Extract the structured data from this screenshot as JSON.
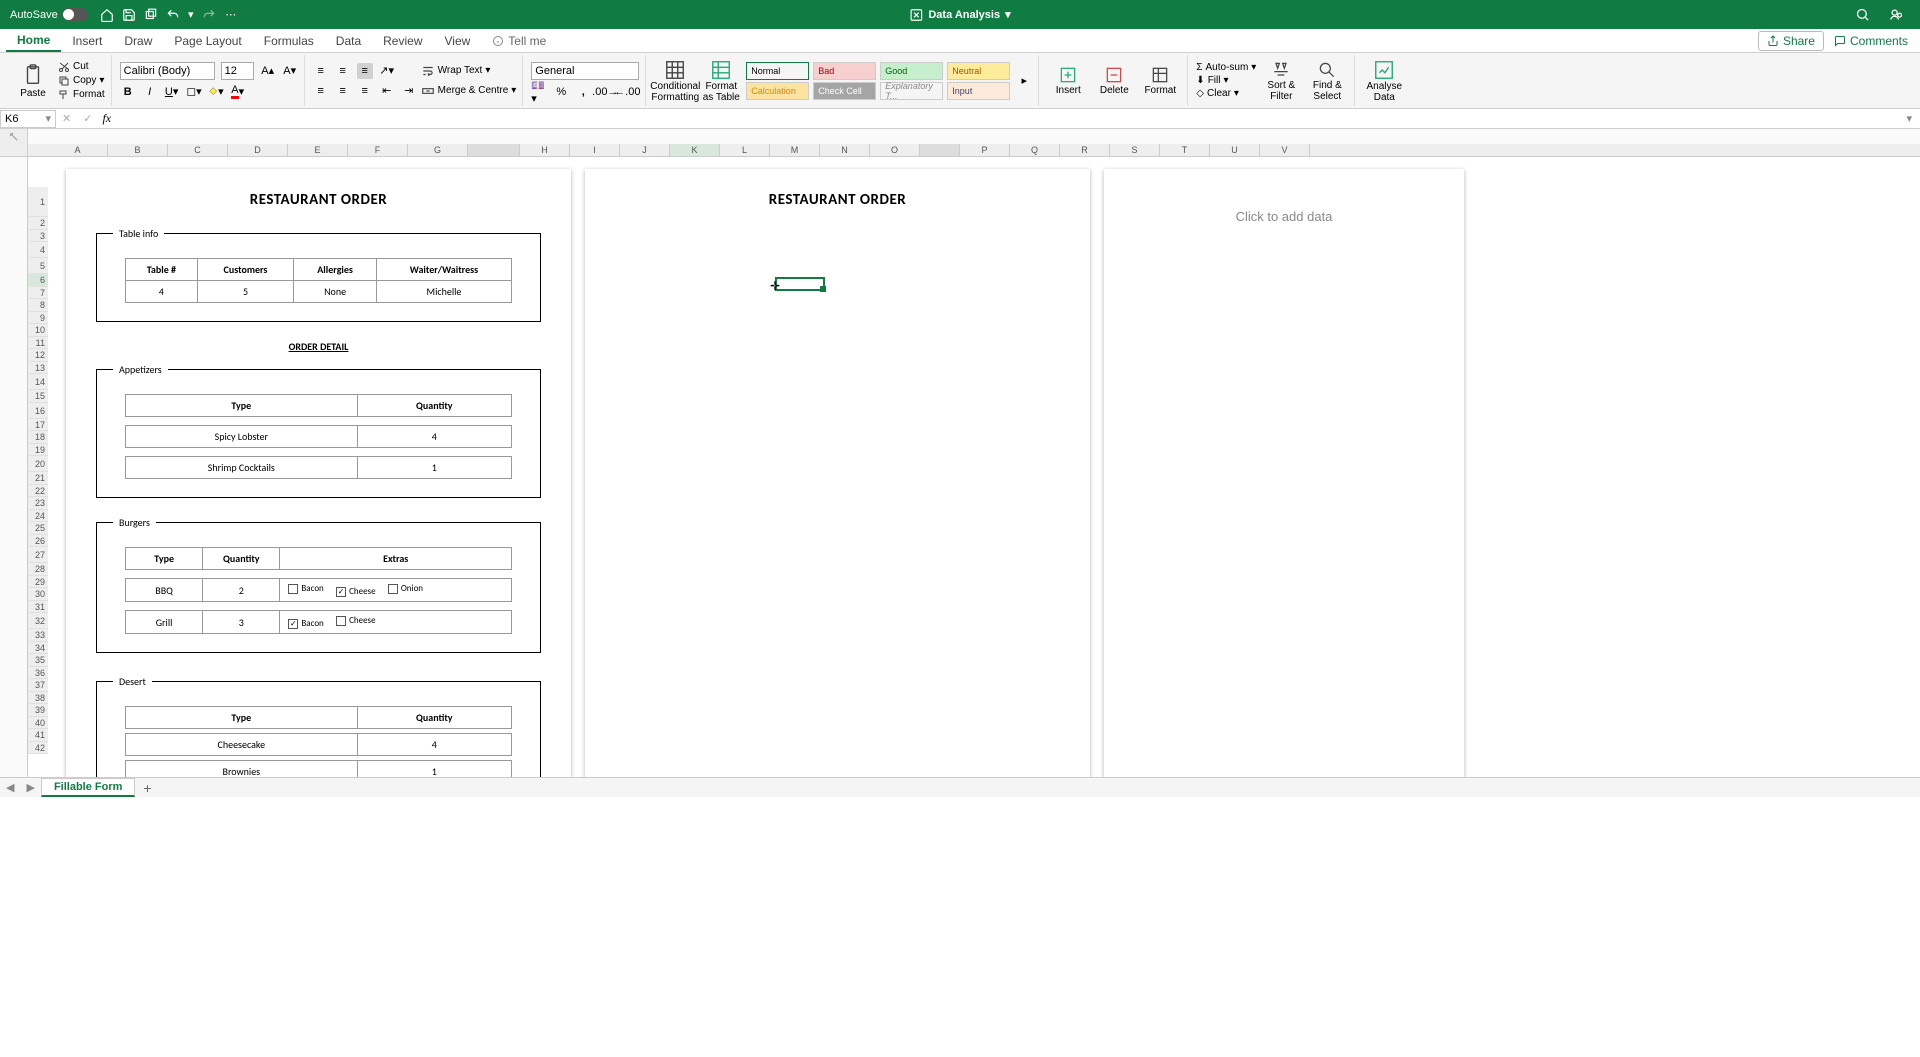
{
  "titlebar": {
    "autosave_label": "AutoSave",
    "autosave_state": "OFF",
    "doc_title": "Data Analysis"
  },
  "tabs": {
    "items": [
      "Home",
      "Insert",
      "Draw",
      "Page Layout",
      "Formulas",
      "Data",
      "Review",
      "View"
    ],
    "tell_me": "Tell me",
    "share": "Share",
    "comments": "Comments"
  },
  "ribbon": {
    "paste": "Paste",
    "cut": "Cut",
    "copy": "Copy",
    "format_painter": "Format",
    "font_name": "Calibri (Body)",
    "font_size": "12",
    "wrap_text": "Wrap Text",
    "merge_centre": "Merge & Centre",
    "number_format": "General",
    "cond_fmt": "Conditional Formatting",
    "fmt_table": "Format as Table",
    "styles": {
      "normal": "Normal",
      "bad": "Bad",
      "good": "Good",
      "neutral": "Neutral",
      "calculation": "Calculation",
      "check_cell": "Check Cell",
      "explanatory": "Explanatory T...",
      "input": "Input"
    },
    "insert": "Insert",
    "delete": "Delete",
    "format": "Format",
    "autosum": "Auto-sum",
    "fill": "Fill",
    "clear": "Clear",
    "sort_filter": "Sort & Filter",
    "find_select": "Find & Select",
    "analyse": "Analyse Data"
  },
  "namebox": {
    "ref": "K6"
  },
  "columns": [
    "A",
    "B",
    "C",
    "D",
    "E",
    "F",
    "G",
    "",
    "H",
    "I",
    "J",
    "K",
    "L",
    "M",
    "N",
    "O",
    "",
    "P",
    "Q",
    "R",
    "S",
    "T",
    "U",
    "V"
  ],
  "active_col": "K",
  "active_row": 6,
  "sheet": {
    "page_title": "RESTAURANT ORDER",
    "table_info_legend": "Table info",
    "table_info": {
      "headers": [
        "Table #",
        "Customers",
        "Allergies",
        "Waiter/Waitress"
      ],
      "values": [
        "4",
        "5",
        "None",
        "Michelle"
      ]
    },
    "order_detail_label": "ORDER DETAIL",
    "appetizers_legend": "Appetizers",
    "appetizers": {
      "headers": [
        "Type",
        "Quantity"
      ],
      "rows": [
        {
          "type": "Spicy Lobster",
          "qty": "4"
        },
        {
          "type": "Shrimp Cocktails",
          "qty": "1"
        }
      ]
    },
    "burgers_legend": "Burgers",
    "burgers": {
      "headers": [
        "Type",
        "Quantity",
        "Extras"
      ],
      "rows": [
        {
          "type": "BBQ",
          "qty": "2",
          "extras": [
            {
              "label": "Bacon",
              "checked": false
            },
            {
              "label": "Cheese",
              "checked": true
            },
            {
              "label": "Onion",
              "checked": false
            }
          ]
        },
        {
          "type": "Grill",
          "qty": "3",
          "extras": [
            {
              "label": "Bacon",
              "checked": true
            },
            {
              "label": "Cheese",
              "checked": false
            }
          ]
        }
      ]
    },
    "desert_legend": "Desert",
    "desert": {
      "headers": [
        "Type",
        "Quantity"
      ],
      "rows": [
        {
          "type": "Cheesecake",
          "qty": "4"
        },
        {
          "type": "Brownies",
          "qty": "1"
        }
      ]
    }
  },
  "side_pane": {
    "placeholder": "Click to add data"
  },
  "sheet_tabs": {
    "active": "Fillable Form"
  }
}
